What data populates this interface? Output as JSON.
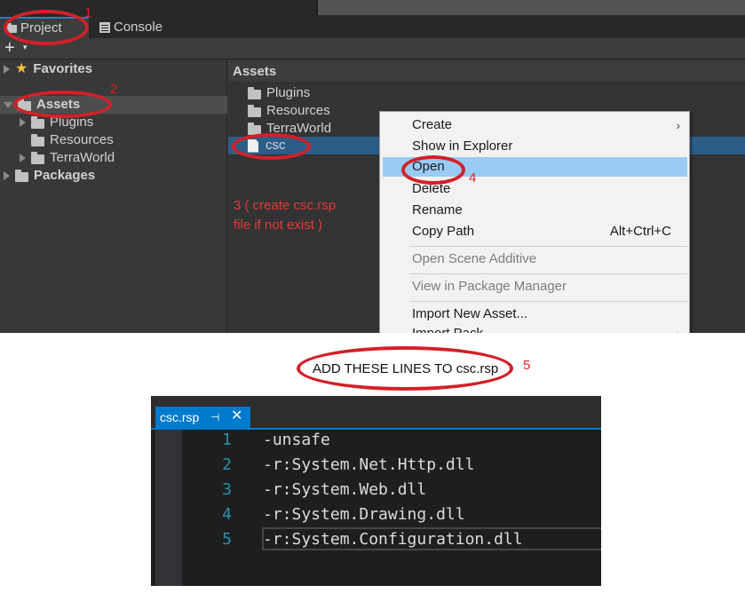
{
  "unity": {
    "tabs": {
      "project": "Project",
      "console": "Console"
    },
    "toolbar": {
      "add": "+",
      "add_arrow": "▾"
    },
    "tree": {
      "favorites": "Favorites",
      "assets": "Assets",
      "plugins": "Plugins",
      "resources": "Resources",
      "terraworld": "TerraWorld",
      "packages": "Packages"
    },
    "right": {
      "header": "Assets",
      "items": [
        "Plugins",
        "Resources",
        "TerraWorld",
        "csc"
      ]
    },
    "note": {
      "line1": "3 ( create csc.rsp",
      "line2": "file if not exist )"
    },
    "context_menu": {
      "create": "Create",
      "show_in_explorer": "Show in Explorer",
      "open": "Open",
      "delete": "Delete",
      "rename": "Rename",
      "copy_path": "Copy Path",
      "copy_path_shortcut": "Alt+Ctrl+C",
      "open_scene_additive": "Open Scene Additive",
      "view_in_package_manager": "View in Package Manager",
      "import_new_asset": "Import New Asset...",
      "import_package_partial": "Import Pack"
    },
    "annotations": {
      "n1": "1",
      "n2": "2",
      "n4": "4"
    }
  },
  "instruction": {
    "text": "ADD THESE LINES TO csc.rsp",
    "number": "5"
  },
  "editor": {
    "tab_label": "csc.rsp",
    "pin_glyph": "⊣",
    "close_glyph": "✕",
    "lines": [
      {
        "no": "1",
        "text": "-unsafe"
      },
      {
        "no": "2",
        "text": "-r:System.Net.Http.dll"
      },
      {
        "no": "3",
        "text": "-r:System.Web.dll"
      },
      {
        "no": "4",
        "text": "-r:System.Drawing.dll"
      },
      {
        "no": "5",
        "text": "-r:System.Configuration.dll"
      }
    ]
  },
  "colors": {
    "annotation_red": "#d32027",
    "selection_blue": "#2c5d87",
    "menu_highlight": "#99cbf5",
    "editor_tab_blue": "#007acc",
    "line_number": "#2b91af"
  }
}
